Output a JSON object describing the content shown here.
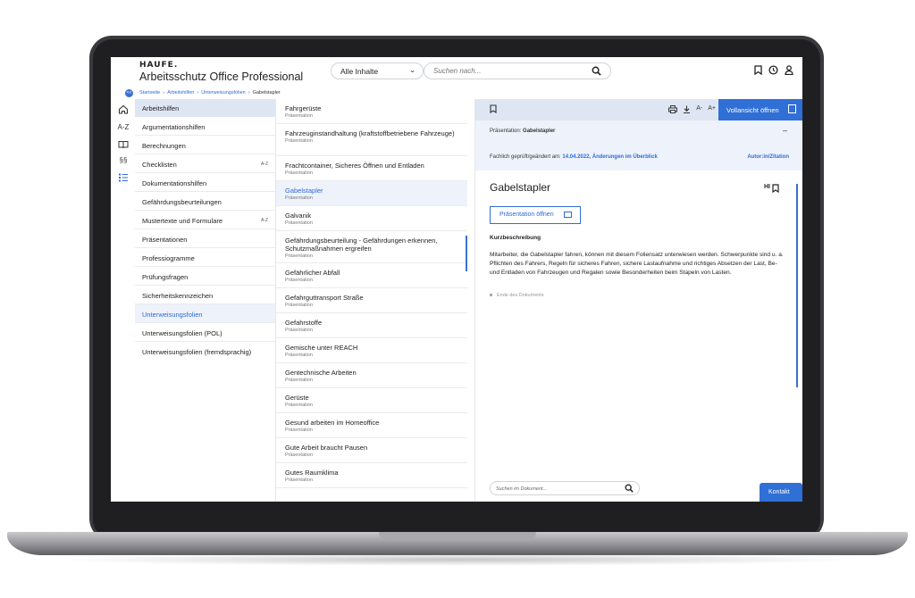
{
  "header": {
    "logo": "HAUFE.",
    "app_title": "Arbeitsschutz Office Professional",
    "scope_select": "Alle Inhalte",
    "search_placeholder": "Suchen nach..."
  },
  "breadcrumb": {
    "toggle": "<<",
    "items": [
      "Startseite",
      "Arbeitshilfen",
      "Unterweisungsfolien",
      "Gabelstapler"
    ],
    "separator": "›"
  },
  "rail": {
    "icons": [
      "home-icon",
      "a-z-index-icon",
      "book-icon",
      "paragraph-icon",
      "list-icon"
    ],
    "labels": {
      "az": "A-Z",
      "paragraph": "§§"
    }
  },
  "categories": {
    "heading": "Arbeitshilfen",
    "items": [
      {
        "label": "Argumentationshilfen",
        "az": ""
      },
      {
        "label": "Berechnungen",
        "az": ""
      },
      {
        "label": "Checklisten",
        "az": "A-Z"
      },
      {
        "label": "Dokumentationshilfen",
        "az": ""
      },
      {
        "label": "Gefährdungsbeurteilungen",
        "az": ""
      },
      {
        "label": "Mustertexte und Formulare",
        "az": "A-Z"
      },
      {
        "label": "Präsentationen",
        "az": ""
      },
      {
        "label": "Professiogramme",
        "az": ""
      },
      {
        "label": "Prüfungsfragen",
        "az": ""
      },
      {
        "label": "Sicherheitskennzeichen",
        "az": ""
      },
      {
        "label": "Unterweisungsfolien",
        "az": "",
        "active": true
      },
      {
        "label": "Unterweisungsfolien (POL)",
        "az": ""
      },
      {
        "label": "Unterweisungsfolien (fremdsprachig)",
        "az": ""
      }
    ]
  },
  "documents": {
    "subtitle": "Präsentation",
    "items": [
      {
        "title": "Fahrgerüste"
      },
      {
        "title": "Fahrzeuginstandhaltung (kraftstoffbetriebene Fahrzeuge)"
      },
      {
        "title": "Frachtcontainer, Sicheres Öffnen und Entladen"
      },
      {
        "title": "Gabelstapler",
        "selected": true
      },
      {
        "title": "Galvanik"
      },
      {
        "title": "Gefährdungsbeurteilung - Gefährdungen erkennen, Schutzmaßnahmen ergreifen"
      },
      {
        "title": "Gefährlicher Abfall"
      },
      {
        "title": "Gefahrguttransport Straße"
      },
      {
        "title": "Gefahrstoffe"
      },
      {
        "title": "Gemische unter REACH"
      },
      {
        "title": "Gentechnische Arbeiten"
      },
      {
        "title": "Gerüste"
      },
      {
        "title": "Gesund arbeiten im Homeoffice"
      },
      {
        "title": "Gute Arbeit braucht Pausen"
      },
      {
        "title": "Gutes Raumklima"
      }
    ]
  },
  "detail": {
    "toolbar": {
      "font_smaller": "A-",
      "font_larger": "A+",
      "full_view": "Vollansicht öffnen"
    },
    "meta": {
      "type_label": "Präsentation:",
      "type_value": "Gabelstapler",
      "collapse": "–",
      "checked_label": "Fachlich geprüft/geändert am:",
      "checked_date": "14.04.2022,",
      "changes_link": "Änderungen im Überblick",
      "author_link": "Autor:in/Zitation"
    },
    "title": "Gabelstapler",
    "highlight": "HI",
    "open_presentation": "Präsentation öffnen",
    "summary_heading": "Kurzbeschreibung",
    "summary_text": "Mitarbeiter, die Gabelstapler fahren, können mit diesem Foliensatz unterwiesen werden. Schwerpunkte sind u. a. Pflichten des Fahrers, Regeln für sicheres Fahren, sichere Lastaufnahme und richtiges Absetzen der Last, Be- und Entladen von Fahrzeugen und Regalen sowie Besonderheiten beim Stapeln von Lasten.",
    "end_of_document": "Ende des Dokuments",
    "doc_search_placeholder": "Suchen im Dokument...",
    "contact_button": "Kontakt"
  },
  "colors": {
    "accent": "#2f6fd6",
    "panel_bg": "#dfe6f3",
    "selected_bg": "#eef2fa"
  }
}
